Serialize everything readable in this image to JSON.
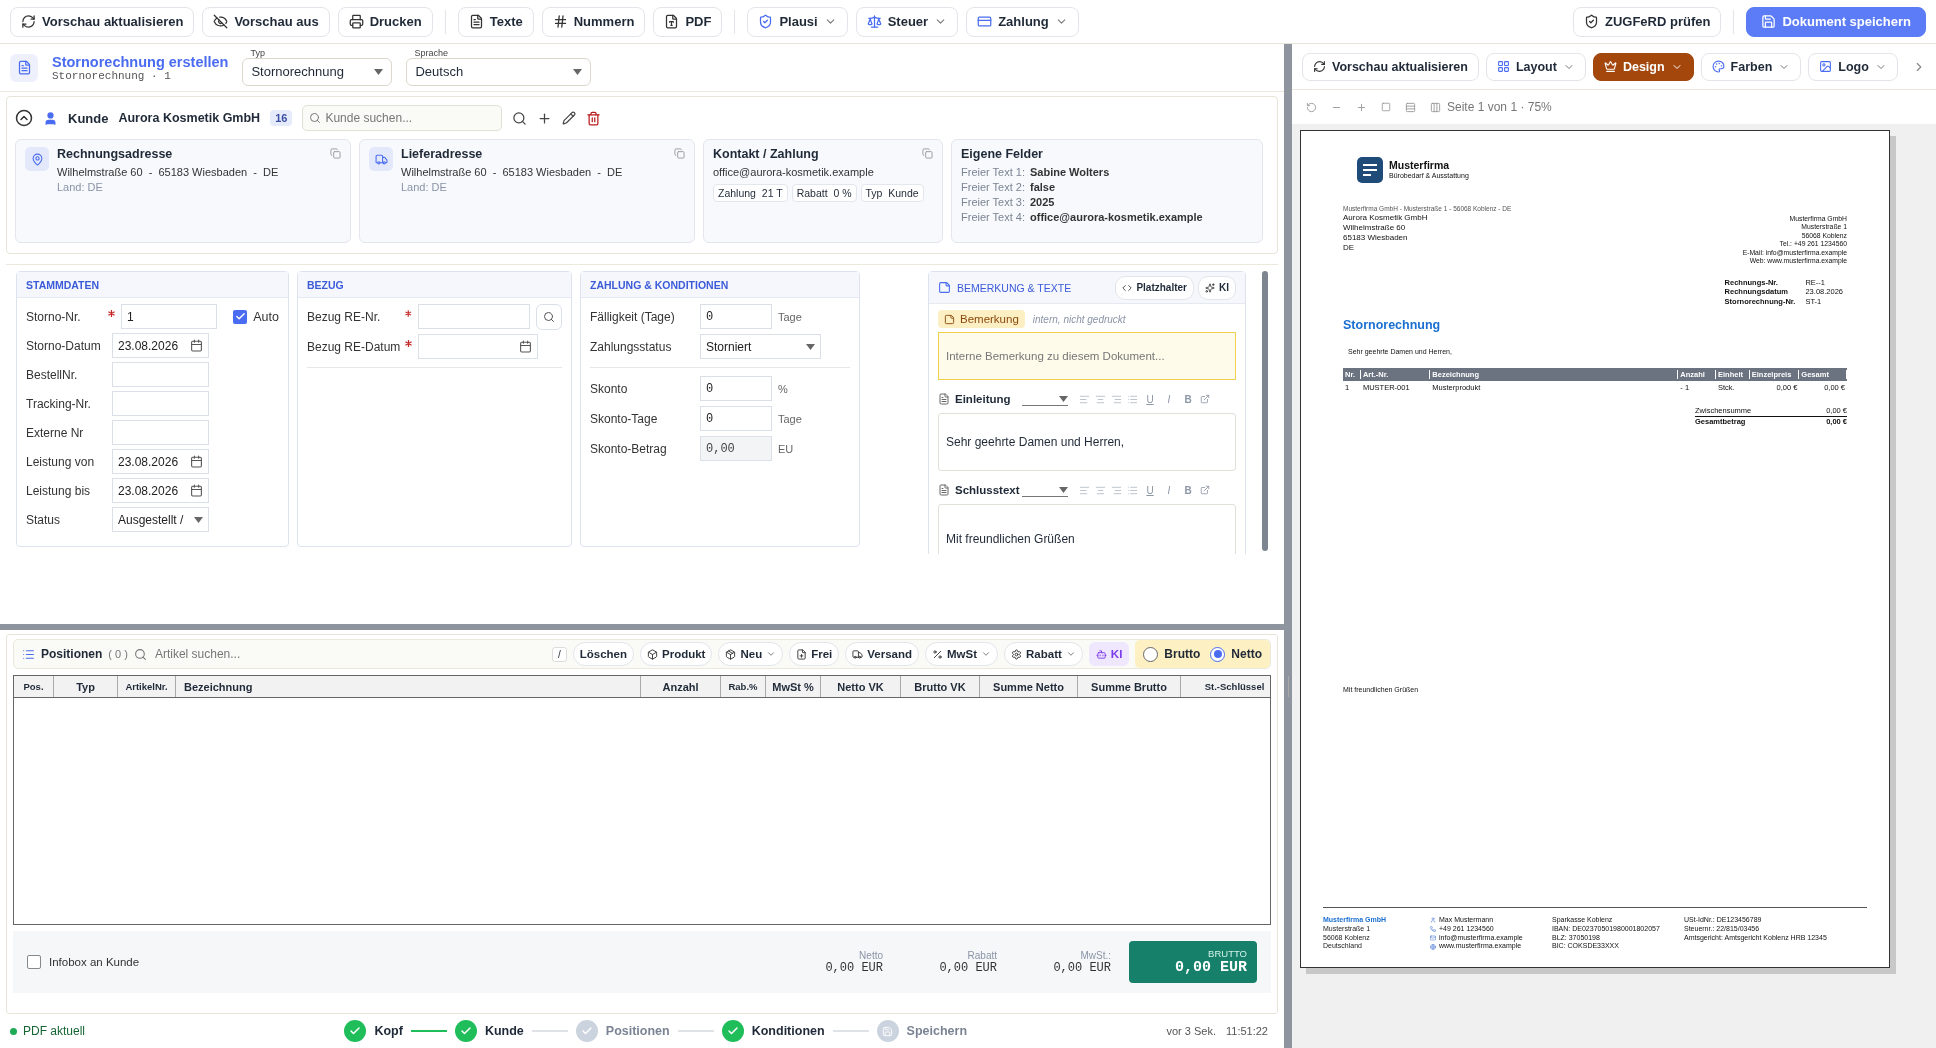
{
  "toolbar": {
    "groups": [
      [
        {
          "label": "Vorschau aktualisieren",
          "has_menu": false
        },
        {
          "label": "Vorschau aus",
          "has_menu": false
        },
        {
          "label": "Drucken",
          "has_menu": false
        }
      ],
      [
        {
          "label": "Texte",
          "has_menu": false
        },
        {
          "label": "Nummern",
          "has_menu": false
        },
        {
          "label": "PDF",
          "has_menu": false
        }
      ],
      [
        {
          "label": "Plausi",
          "has_menu": true
        },
        {
          "label": "Steuer",
          "has_menu": true
        },
        {
          "label": "Zahlung",
          "has_menu": true
        }
      ]
    ],
    "check": {
      "label": "ZUGFeRD prüfen"
    },
    "save": {
      "label": "Dokument speichern"
    }
  },
  "header": {
    "title": "Stornorechnung erstellen",
    "subtitle": "Stornorechnung · 1",
    "selects": [
      {
        "label": "Typ",
        "value": "Stornorechnung"
      },
      {
        "label": "Sprache",
        "value": "Deutsch"
      }
    ]
  },
  "customer": {
    "expanded": true,
    "label": "Kunde",
    "name": "Aurora Kosmetik GmbH",
    "count": "16",
    "search_placeholder": "Kunde suchen...",
    "cards": [
      {
        "kind": "address",
        "title": "Rechnungsadresse",
        "line": "Wilhelmstraße 60  -  65183 Wiesbaden  -  DE",
        "country_label": "Land:",
        "country": "DE"
      },
      {
        "kind": "address",
        "title": "Lieferadresse",
        "line": "Wilhelmstraße 60  -  65183 Wiesbaden  -  DE",
        "country_label": "Land:",
        "country": "DE"
      },
      {
        "kind": "contact",
        "title": "Kontakt / Zahlung",
        "email": "office@aurora-kosmetik.example",
        "chips": [
          {
            "label": "Zahlung",
            "value": "21 T"
          },
          {
            "label": "Rabatt",
            "value": "0 %"
          },
          {
            "label": "Typ",
            "value": "Kunde"
          }
        ]
      },
      {
        "kind": "fields",
        "title": "Eigene Felder",
        "rows": [
          {
            "label": "Freier Text 1:",
            "value": "Sabine Wolters"
          },
          {
            "label": "Freier Text 2:",
            "value": "false"
          },
          {
            "label": "Freier Text 3:",
            "value": "2025"
          },
          {
            "label": "Freier Text 4:",
            "value": "office@aurora-kosmetik.example"
          }
        ]
      }
    ]
  },
  "stammdaten": {
    "title": "STAMMDATEN",
    "rows": [
      {
        "kind": "text",
        "label": "Storno-Nr.",
        "required": true,
        "value": "1",
        "auto": {
          "label": "Auto",
          "checked": true
        }
      },
      {
        "kind": "date",
        "label": "Storno-Datum",
        "required": false,
        "value": "23.08.2026"
      },
      {
        "kind": "text",
        "label": "BestellNr.",
        "required": false
      },
      {
        "kind": "text",
        "label": "Tracking-Nr.",
        "required": false
      },
      {
        "kind": "text",
        "label": "Externe Nr",
        "required": false
      },
      {
        "kind": "date",
        "label": "Leistung von",
        "required": false,
        "value": "23.08.2026"
      },
      {
        "kind": "date",
        "label": "Leistung bis",
        "required": false,
        "value": "23.08.2026"
      },
      {
        "kind": "select",
        "label": "Status",
        "required": false,
        "value": "Ausgestellt /"
      }
    ]
  },
  "bezug": {
    "title": "BEZUG",
    "rows": [
      {
        "kind": "search",
        "label": "Bezug RE-Nr.",
        "required": true
      },
      {
        "kind": "date",
        "label": "Bezug RE-Datum",
        "required": true
      }
    ]
  },
  "zahlung": {
    "title": "ZAHLUNG & KONDITIONEN",
    "groups": [
      [
        {
          "kind": "text",
          "label": "Fälligkeit (Tage)",
          "value": "0",
          "unit": "Tage",
          "disabled": false
        },
        {
          "kind": "select",
          "label": "Zahlungsstatus",
          "value": "Storniert",
          "disabled": false
        }
      ],
      [
        {
          "kind": "text",
          "label": "Skonto",
          "value": "0",
          "unit": "%",
          "disabled": false
        },
        {
          "kind": "text",
          "label": "Skonto-Tage",
          "value": "0",
          "unit": "Tage",
          "disabled": false
        },
        {
          "kind": "text",
          "label": "Skonto-Betrag",
          "value": "0,00",
          "unit": "EU",
          "disabled": true
        }
      ]
    ]
  },
  "notes": {
    "title": "BEMERKUNG & TEXTE",
    "buttons": [
      {
        "label": "Platzhalter"
      },
      {
        "label": "KI"
      }
    ],
    "note": {
      "label": "Bemerkung",
      "hint": "intern, nicht gedruckt",
      "placeholder": "Interne Bemerkung zu diesem Dokument..."
    },
    "editors": [
      {
        "label": "Einleitung",
        "format_marks": [
          "U",
          "I",
          "B"
        ],
        "text": "Sehr geehrte Damen und Herren,"
      },
      {
        "label": "Schlusstext",
        "format_marks": [
          "U",
          "I",
          "B"
        ],
        "text": "Mit freundlichen Grüßen"
      }
    ]
  },
  "positions": {
    "title": "Positionen",
    "count": "( 0 )",
    "search_placeholder": "Artikel suchen...",
    "shortcut": "/",
    "actions": [
      {
        "label": "Löschen",
        "has_menu": false
      },
      {
        "label": "Produkt",
        "has_menu": false
      },
      {
        "label": "Neu",
        "has_menu": true
      },
      {
        "label": "Frei",
        "has_menu": false
      },
      {
        "label": "Versand",
        "has_menu": false
      },
      {
        "label": "MwSt",
        "has_menu": true
      },
      {
        "label": "Rabatt",
        "has_menu": true
      },
      {
        "label": "KI",
        "has_menu": false
      }
    ],
    "price_mode": [
      {
        "label": "Brutto",
        "selected": false
      },
      {
        "label": "Netto",
        "selected": true
      }
    ],
    "columns": [
      "Pos.",
      "Typ",
      "ArtikelNr.",
      "Bezeichnung",
      "Anzahl",
      "Rab.%",
      "MwSt %",
      "Netto VK",
      "Brutto VK",
      "Summe Netto",
      "Summe Brutto",
      "St.-Schlüssel"
    ],
    "infobox": {
      "label": "Infobox an Kunde",
      "checked": false
    },
    "totals": [
      {
        "label": "Netto",
        "value": "0,00 EUR"
      },
      {
        "label": "Rabatt",
        "value": "0,00 EUR"
      },
      {
        "label": "MwSt.:",
        "value": "0,00 EUR"
      }
    ],
    "grand_total": {
      "label": "BRUTTO",
      "value": "0,00 EUR"
    }
  },
  "status_bar": {
    "pdf_state": "PDF aktuell",
    "steps": [
      {
        "label": "Kopf",
        "kind": "check",
        "done": true
      },
      {
        "label": "Kunde",
        "kind": "check",
        "done": true
      },
      {
        "label": "Positionen",
        "kind": "check",
        "done": false
      },
      {
        "label": "Konditionen",
        "kind": "check",
        "done": true
      },
      {
        "label": "Speichern",
        "kind": "save",
        "done": false
      }
    ],
    "saved_ago": "vor 3 Sek.",
    "time": "11:51:22"
  },
  "preview": {
    "toolbar": [
      {
        "label": "Vorschau aktualisieren",
        "has_menu": false,
        "selected": false
      },
      {
        "label": "Layout",
        "has_menu": true,
        "selected": false
      },
      {
        "label": "Design",
        "has_menu": true,
        "selected": true
      },
      {
        "label": "Farben",
        "has_menu": true,
        "selected": false
      },
      {
        "label": "Logo",
        "has_menu": true,
        "selected": false
      }
    ],
    "page_info": "Seite 1 von 1 · 75%",
    "document": {
      "company": "Musterfirma",
      "tagline": "Bürobedarf & Ausstattung",
      "sender_line": "Musterfirma GmbH - Musterstraße 1 - 56068 Koblenz - DE",
      "recipient": [
        "Aurora Kosmetik GmbH",
        "Wilhelmstraße 60",
        "65183 Wiesbaden",
        "DE"
      ],
      "company_block": [
        "Musterfirma GmbH",
        "Musterstraße 1",
        "56068 Koblenz",
        "Tel.: +49 261 1234560",
        "E-Mail: info@musterfirma.example",
        "Web: www.musterfirma.example"
      ],
      "meta": [
        {
          "label": "Rechnungs-Nr.",
          "value": "RE--1"
        },
        {
          "label": "Rechnungsdatum",
          "value": "23.08.2026"
        },
        {
          "label": "Stornorechnung-Nr.",
          "value": "ST-1"
        }
      ],
      "title": "Stornorechnung",
      "greeting": "Sehr geehrte Damen und Herren,",
      "columns": [
        "Nr.",
        "Art.-Nr.",
        "Bezeichnung",
        "Anzahl",
        "Einheit",
        "Einzelpreis",
        "Gesamt"
      ],
      "rows": [
        [
          "1",
          "MUSTER-001",
          "Musterprodukt",
          "- 1",
          "Stck.",
          "0,00 €",
          "0,00 €"
        ]
      ],
      "subtotal": {
        "label": "Zwischensumme",
        "value": "0,00 €"
      },
      "total": {
        "label": "Gesamtbetrag",
        "value": "0,00 €"
      },
      "closing": "Mit freundlichen Grüßen",
      "footer": [
        {
          "kind": "company",
          "lines": [
            "Musterfirma GmbH",
            "Musterstraße 1",
            "56068 Koblenz",
            "Deutschland"
          ]
        },
        {
          "kind": "contact",
          "lines": [
            "Max Mustermann",
            "+49 261 1234560",
            "info@musterfirma.example",
            "www.musterfirma.example"
          ]
        },
        {
          "kind": "plain",
          "lines": [
            "Sparkasse Koblenz",
            "IBAN: DE02370501980001802057",
            "BLZ: 37050198",
            "BIC: COKSDE33XXX"
          ]
        },
        {
          "kind": "plain",
          "lines": [
            "USt-IdNr.: DE123456789",
            "Steuernr.: 22/815/03456",
            "Amtsgericht: Amtsgericht Koblenz HRB 12345"
          ]
        }
      ]
    }
  }
}
